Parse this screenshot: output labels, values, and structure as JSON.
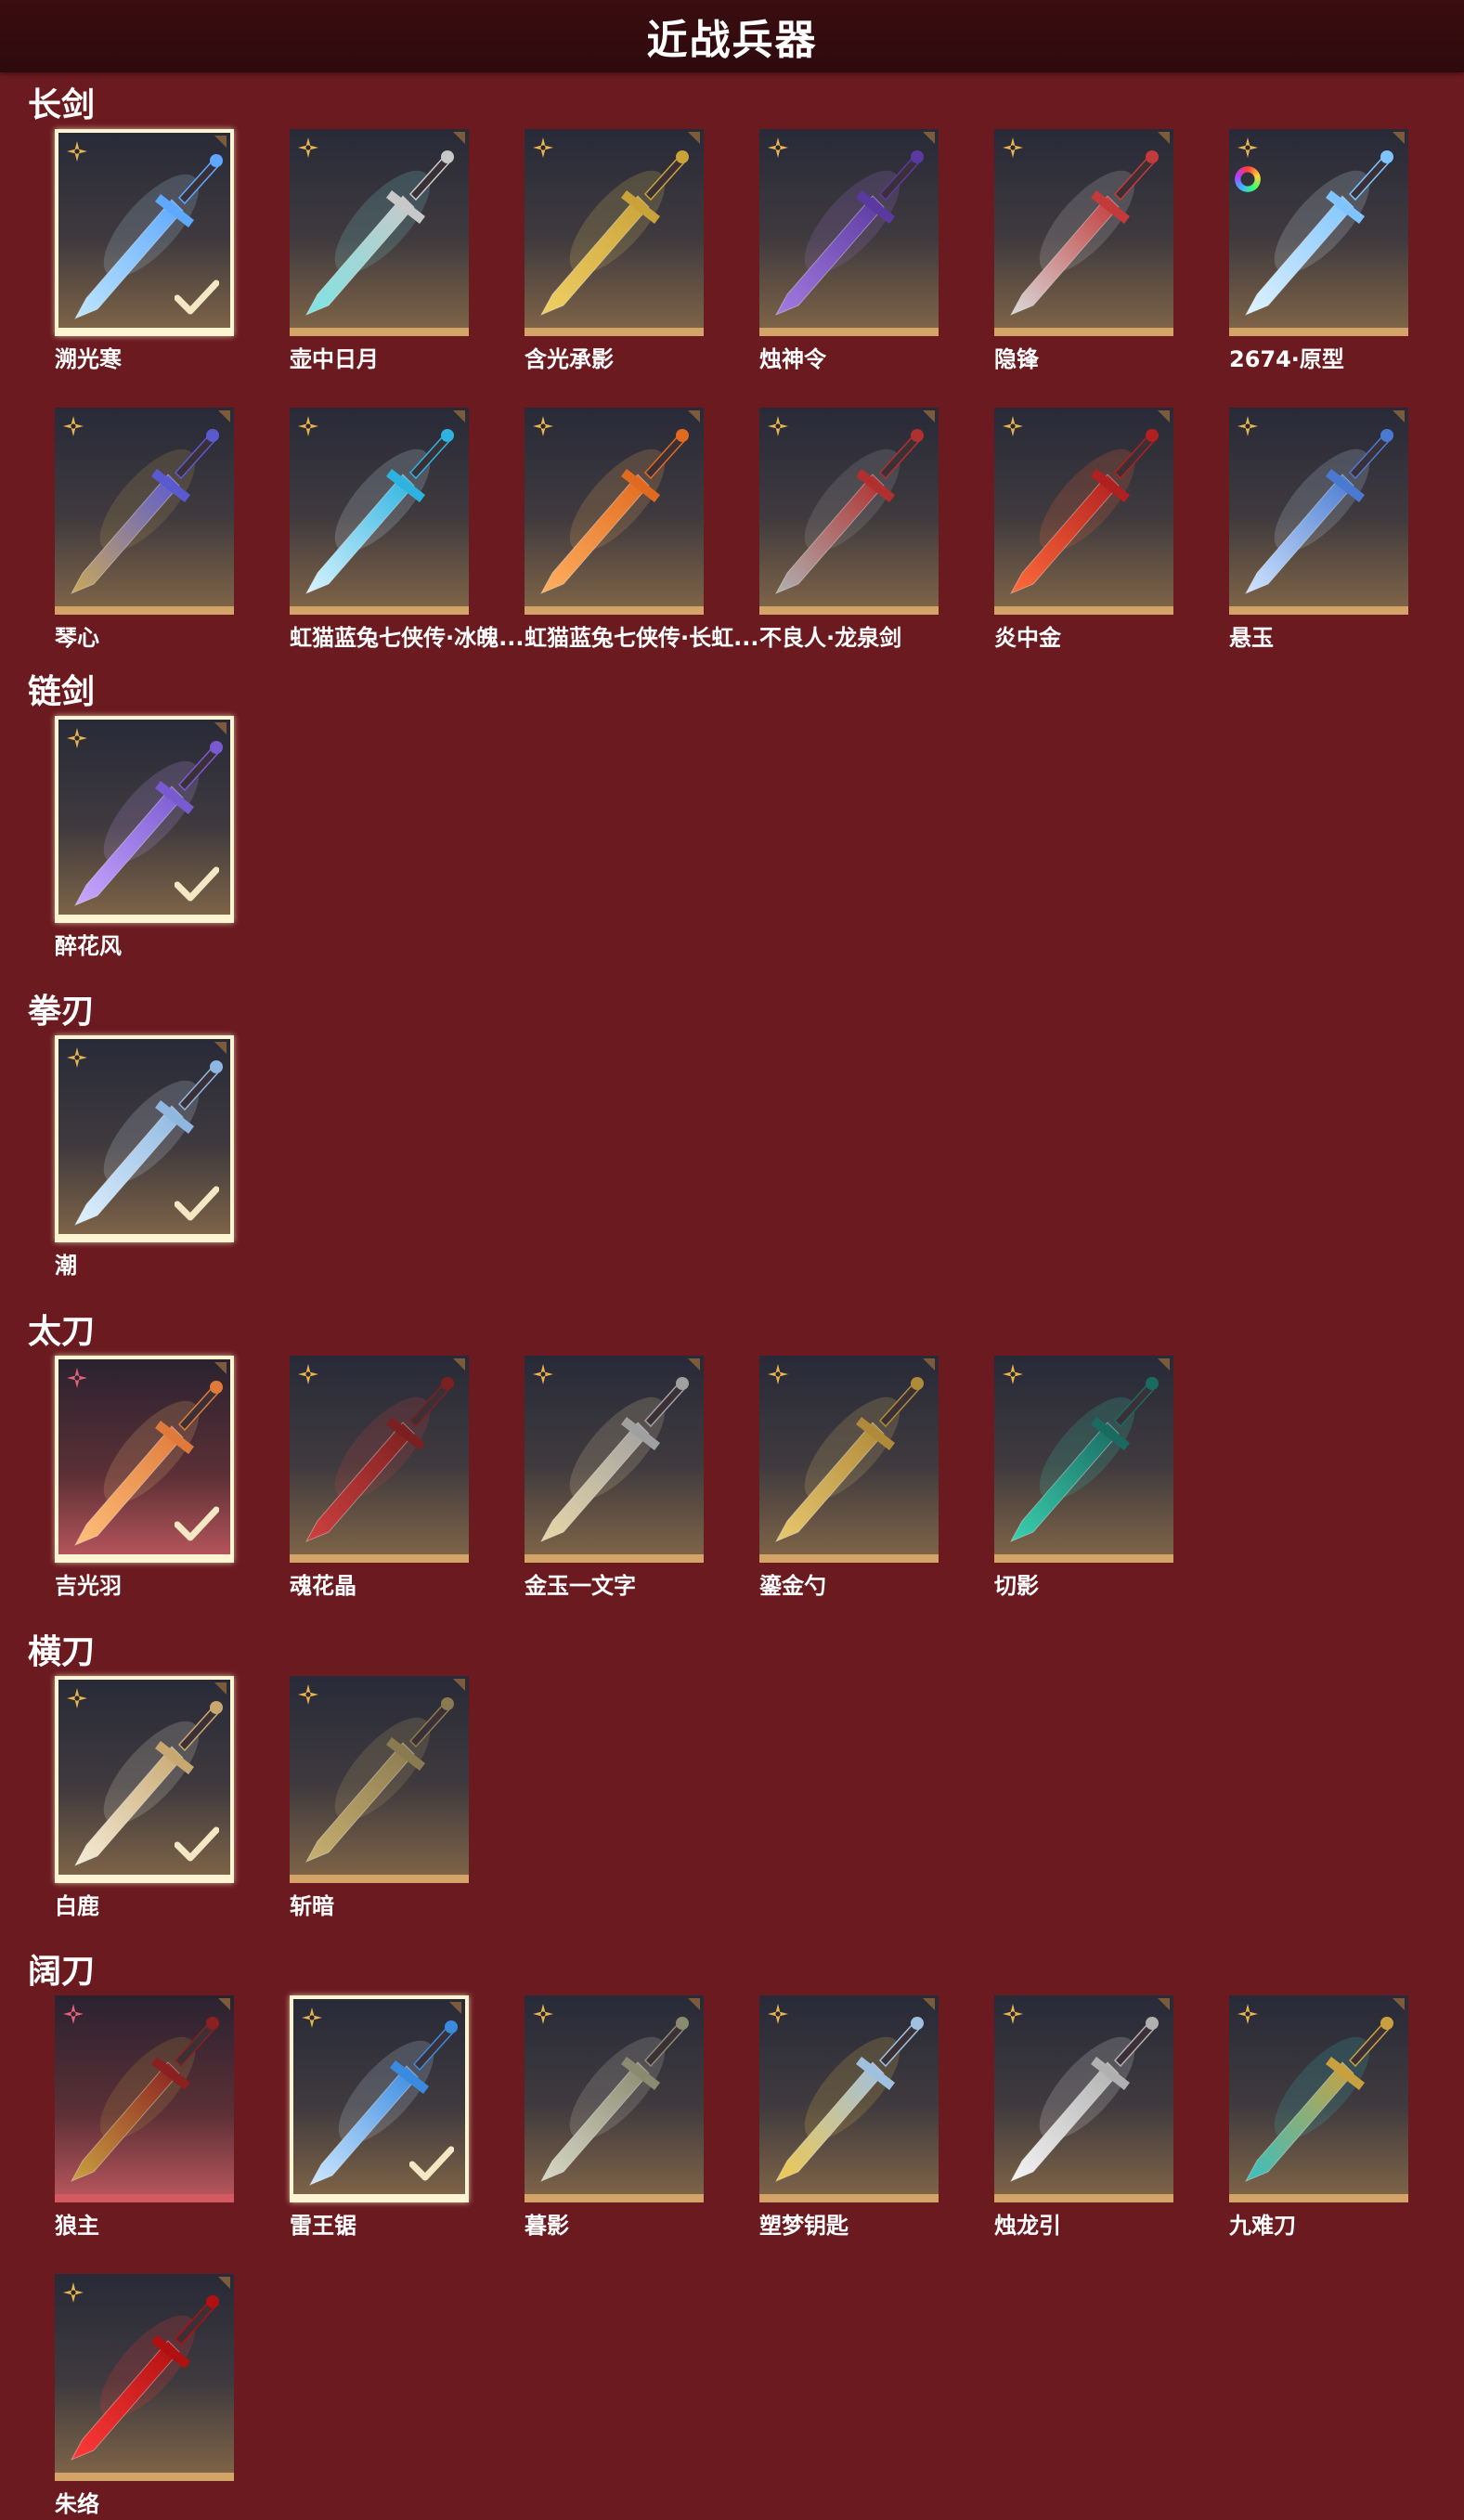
{
  "title": "近战兵器",
  "sections": [
    {
      "title": "长剑",
      "items": [
        {
          "name": "溯光寒",
          "selected": true,
          "badge": "gold",
          "colors": [
            "#bfe6ff",
            "#5ea8ff"
          ]
        },
        {
          "name": "壶中日月",
          "selected": false,
          "badge": "gold",
          "colors": [
            "#7fe3e3",
            "#c8c8c8"
          ]
        },
        {
          "name": "含光承影",
          "selected": false,
          "badge": "gold",
          "colors": [
            "#f0d064",
            "#c9a23a"
          ]
        },
        {
          "name": "烛神令",
          "selected": false,
          "badge": "gold",
          "colors": [
            "#a47be0",
            "#5a3aa0"
          ]
        },
        {
          "name": "隐锋",
          "selected": false,
          "badge": "gold",
          "colors": [
            "#d9d9d9",
            "#c23a3a"
          ]
        },
        {
          "name": "2674·原型",
          "selected": false,
          "badge": "gold",
          "dye": true,
          "colors": [
            "#dff3ff",
            "#7fc4ff"
          ]
        },
        {
          "name": "琴心",
          "selected": false,
          "badge": "gold",
          "colors": [
            "#c9a85a",
            "#5a5ad0"
          ]
        },
        {
          "name": "虹猫蓝兔七侠传·冰魄...",
          "selected": false,
          "badge": "gold",
          "colors": [
            "#d8f4ff",
            "#2eb3e0"
          ]
        },
        {
          "name": "虹猫蓝兔七侠传·长虹...",
          "selected": false,
          "badge": "gold",
          "colors": [
            "#ffb060",
            "#e06a20"
          ]
        },
        {
          "name": "不良人·龙泉剑",
          "selected": false,
          "badge": "gold",
          "colors": [
            "#b0b0b0",
            "#b03030"
          ]
        },
        {
          "name": "炎中金",
          "selected": false,
          "badge": "gold",
          "colors": [
            "#ff6a3a",
            "#b02020"
          ]
        },
        {
          "name": "悬玉",
          "selected": false,
          "badge": "gold",
          "colors": [
            "#cfe4ff",
            "#4a7ad0"
          ]
        }
      ]
    },
    {
      "title": "链剑",
      "items": [
        {
          "name": "醉花风",
          "selected": true,
          "badge": "gold",
          "colors": [
            "#c9a8ff",
            "#7a5ad0"
          ]
        }
      ]
    },
    {
      "title": "拳刃",
      "items": [
        {
          "name": "潮",
          "selected": true,
          "badge": "gold",
          "colors": [
            "#dff1ff",
            "#8fb7e0"
          ]
        }
      ]
    },
    {
      "title": "太刀",
      "items": [
        {
          "name": "吉光羽",
          "selected": true,
          "badge": "pink",
          "rare": true,
          "colors": [
            "#ffc07a",
            "#e07a3a"
          ]
        },
        {
          "name": "魂花晶",
          "selected": false,
          "badge": "gold",
          "colors": [
            "#d04040",
            "#7a2020"
          ]
        },
        {
          "name": "金玉一文字",
          "selected": false,
          "badge": "gold",
          "colors": [
            "#e8d8a8",
            "#a0a0a0"
          ]
        },
        {
          "name": "鎏金勺",
          "selected": false,
          "badge": "gold",
          "colors": [
            "#e8c870",
            "#b08a3a"
          ]
        },
        {
          "name": "切影",
          "selected": false,
          "badge": "gold",
          "colors": [
            "#3ad0b0",
            "#1a6a60"
          ]
        }
      ]
    },
    {
      "title": "横刀",
      "items": [
        {
          "name": "白鹿",
          "selected": true,
          "badge": "gold",
          "colors": [
            "#f4ecd8",
            "#c8a870"
          ]
        },
        {
          "name": "斩暗",
          "selected": false,
          "badge": "gold",
          "colors": [
            "#c8b070",
            "#8a7a50"
          ]
        }
      ]
    },
    {
      "title": "阔刀",
      "items": [
        {
          "name": "狼主",
          "selected": false,
          "badge": "pink",
          "rare": true,
          "colors": [
            "#c9a040",
            "#8a2020"
          ]
        },
        {
          "name": "雷王锯",
          "selected": true,
          "badge": "gold",
          "colors": [
            "#cfe8ff",
            "#3a8ae0"
          ]
        },
        {
          "name": "暮影",
          "selected": false,
          "badge": "gold",
          "colors": [
            "#d8d8c8",
            "#8a8a70"
          ]
        },
        {
          "name": "塑梦钥匙",
          "selected": false,
          "badge": "gold",
          "colors": [
            "#f0c850",
            "#a0c0e0"
          ]
        },
        {
          "name": "烛龙引",
          "selected": false,
          "badge": "gold",
          "colors": [
            "#f4f4f4",
            "#b0b0b0"
          ]
        },
        {
          "name": "九难刀",
          "selected": false,
          "badge": "gold",
          "colors": [
            "#3ac0c0",
            "#c9a040"
          ]
        },
        {
          "name": "朱络",
          "selected": false,
          "badge": "gold",
          "colors": [
            "#ff3a3a",
            "#b01010"
          ]
        }
      ]
    }
  ]
}
